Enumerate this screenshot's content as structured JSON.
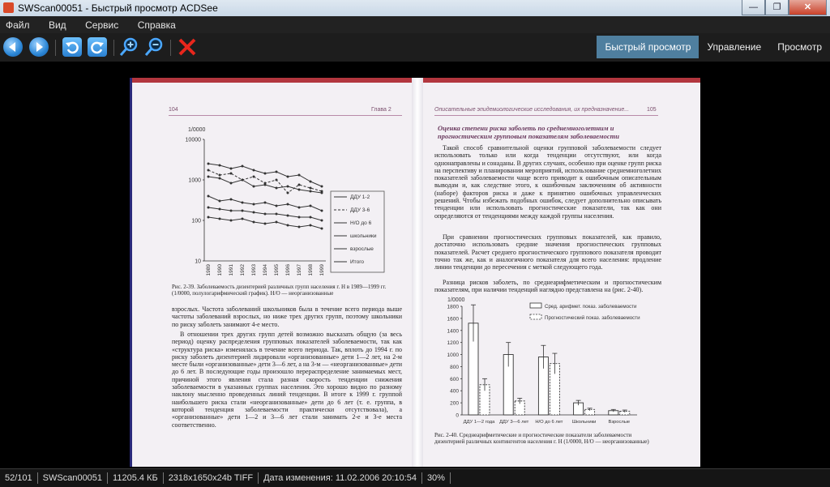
{
  "window": {
    "title": "SWScan00051 - Быстрый просмотр ACDSee"
  },
  "menu": {
    "items": [
      "Файл",
      "Вид",
      "Сервис",
      "Справка"
    ]
  },
  "tabs": {
    "quickview": "Быстрый просмотр",
    "manage": "Управление",
    "view": "Просмотр"
  },
  "scan": {
    "left": {
      "page_number": "104",
      "chapter": "Глава 2",
      "chart": {
        "ylabel": "1/0000",
        "yticks": [
          "10000",
          "1000",
          "100",
          "10"
        ],
        "years": [
          "1989",
          "1990",
          "1991",
          "1992",
          "1993",
          "1994",
          "1995",
          "1996",
          "1997",
          "1998",
          "1999"
        ],
        "legend": [
          "ДДУ 1-2",
          "ДДУ 3-6",
          "Н/О до 6",
          "школьники",
          "взрослые",
          "Итого"
        ]
      },
      "caption": "Рис. 2-39. Заболеваемость дизентерией различных групп населения г. Н в 1989—1999 гг. (1/0000, полулогарифмический график). Н/О — неорганизованные",
      "paragraph1": "взрослых. Частота заболеваний школьников была в течение всего периода выше частоты заболеваний взрослых, но ниже трех других групп, поэтому школьники по риску заболеть занимают 4-е место.",
      "paragraph2": "В отношении трех других групп детей возможно высказать общую (за весь период) оценку распределения групповых показателей заболеваемости, так как «структура риска» изменялась в течение всего периода. Так, вплоть до 1994 г. по риску заболеть дизентерией лидировали «организованные» дети 1—2 лет, на 2-м месте были «организованные» дети 3—6 лет, а на 3-м — «неорганизованные» дети до 6 лет. В последующие годы произошло перераспределение занимаемых мест, причиной этого явления стала разная скорость тенденции снижения заболеваемости в указанных группах населения. Это хорошо видно по разному наклону мысленно проведенных линий тенденции. В итоге к 1999 г. группой наибольшего риска стали «неорганизованные» дети до 6 лет (т. е. группа, в которой тенденция заболеваемости практически отсутствовала), а «организованные» дети 1—2 и 3—6 лет стали занимать 2-е и 3-е места соответственно."
    },
    "right": {
      "running_head": "Описательные эпидемиологические исследования, их предназначение...",
      "page_number": "105",
      "section_title": "Оценка степени риска заболеть по среднемноголетним и прогностическим групповым показателям заболеваемости",
      "paragraph1": "Такой способ сравнительной оценки групповой заболеваемости следует использовать только или когда тенденции отсутствуют, или когда однонаправлены и сонаданы. В других случаях, особенно при оценке групп риска на перспективу и планировании мероприятий, использование среднемноголетних показателей заболеваемости чаще всего приводит к ошибочным описательным выводам и, как следствие этого, к ошибочным заключениям об активности (наборе) факторов риска и даже к принятию ошибочных управленческих решений. Чтобы избежать подобных ошибок, следует дополнительно описывать тенденции или использовать прогностические показатели, так как они определяются от тенденциями между каждой группы населения.",
      "paragraph2": "При сравнении прогностических групповых показателей, как правило, достаточно использовать средние значения прогностических групповых показателей. Расчет среднего прогностического группового показателя проводит точно так же, как и аналогичного показателя для всего населения: продление линии тенденции до пересечения с меткой следующего года.",
      "paragraph3": "Разница рисков заболеть, по среднеарифметическим и прогностическим показателям, при наличии тенденций наглядно представлена на (рис. 2-40).",
      "chart": {
        "ylabel": "1/0000",
        "yticks": [
          "1800",
          "1600",
          "1400",
          "1200",
          "1000",
          "800",
          "600",
          "400",
          "200",
          "0"
        ],
        "legend": [
          "Сред. арифмет. показ. заболеваемости",
          "Прогностический показ. заболеваемости"
        ],
        "categories": [
          "ДДУ 1—2 года",
          "ДДУ 3—6 лет",
          "Н/О до 6 лет",
          "Школьники",
          "Взрослые"
        ],
        "mean_values": [
          1520,
          1000,
          960,
          200,
          70
        ],
        "forecast_values": [
          500,
          230,
          850,
          90,
          60
        ]
      },
      "caption": "Рис. 2-40. Среднеарифметические и прогностические показатели заболеваемости дизентерией различных контингентов населения г. Н (1/0000, Н/О — неорганизованные)"
    }
  },
  "status": {
    "index": "52/101",
    "filename": "SWScan00051",
    "filesize": "11205.4 КБ",
    "dimensions": "2318x1650x24b TIFF",
    "modified": "Дата изменения: 11.02.2006 20:10:54",
    "zoom": "30%"
  }
}
